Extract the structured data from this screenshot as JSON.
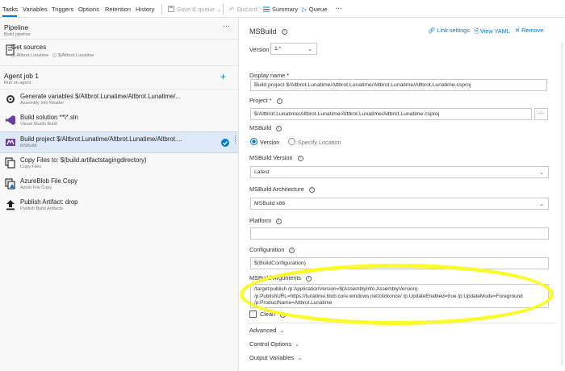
{
  "toolbar": {
    "tabs": [
      "Tasks",
      "Variables",
      "Triggers",
      "Options",
      "Retention",
      "History"
    ],
    "save_queue": "Save & queue",
    "discard": "Discard",
    "summary": "Summary",
    "queue": "Queue",
    "more": "···"
  },
  "pipeline": {
    "title": "Pipeline",
    "subtitle": "Build pipeline",
    "more": "···",
    "get_sources": {
      "title": "Get sources",
      "repo1": "Altbrot.Lunatime",
      "repo2": "$/Altbrot.Lunatime"
    }
  },
  "agent_job": {
    "title": "Agent job 1",
    "subtitle": "Run on agent",
    "add": "+"
  },
  "tasks": [
    {
      "name": "Generate variables $/Altbrot.Lunatime/Altbrot.Lunatime/...",
      "sub": "Assembly Info Reader"
    },
    {
      "name": "Build solution **\\*.sln",
      "sub": "Visual Studio Build"
    },
    {
      "name": "Build project $/Altbrot.Lunatime/Altbrot.Lunatime/Altbrot....",
      "sub": "MSBuild"
    },
    {
      "name": "Copy Files to: $(build.artifactstagingdirectory)",
      "sub": "Copy Files"
    },
    {
      "name": "AzureBlob File Copy",
      "sub": "Azure File Copy"
    },
    {
      "name": "Publish Artifact: drop",
      "sub": "Publish Build Artifacts"
    }
  ],
  "detail": {
    "title": "MSBuild",
    "link_settings": "Link settings",
    "view_yaml": "View YAML",
    "remove": "Remove",
    "version_label": "Version",
    "version_value": "1.*",
    "display_name_label": "Display name *",
    "display_name_value": "Build project $/Altbrot.Lunatime/Altbrot.Lunatime/Altbrot.Lunatime/Altbrot.Lunatime.csproj",
    "project_label": "Project *",
    "project_value": "$/Altbrot.Lunatime/Altbrot.Lunatime/Altbrot.Lunatime/Altbrot.Lunatime.csproj",
    "project_browse": "···",
    "msbuild_label": "MSBuild",
    "radio_version": "Version",
    "radio_location": "Specify Location",
    "msbuild_version_label": "MSBuild Version",
    "msbuild_version_value": "Latest",
    "arch_label": "MSBuild Architecture",
    "arch_value": "MSBuild x86",
    "platform_label": "Platform",
    "platform_value": "",
    "configuration_label": "Configuration",
    "configuration_value": "$(BuildConfiguration)",
    "arguments_label": "MSBuild Arguments",
    "arguments_line1": "/target:publish  /p:ApplicationVersion=$(AssemblyInfo.AssemblyVersion)",
    "arguments_line2": "/p:PublishURL=https://lunatime.blob.core.windows.net/clickonce/   /p:UpdateEnabled=true  /p:UpdateMode=Foreground",
    "arguments_line3": "/p:ProductName=Altbrot.Lunatime",
    "clean_label": "Clean",
    "advanced": "Advanced",
    "control_options": "Control Options",
    "output_variables": "Output Variables"
  },
  "colors": {
    "accent": "#0078d4",
    "highlight": "#fbfb2a",
    "selected_row": "#dde9f6"
  }
}
